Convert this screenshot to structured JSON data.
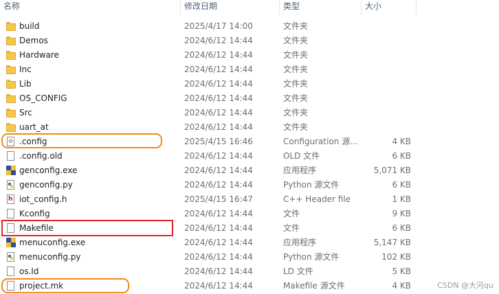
{
  "columns": {
    "name": "名称",
    "date": "修改日期",
    "type": "类型",
    "size": "大小"
  },
  "files": [
    {
      "icon": "folder-icon",
      "name": "build",
      "date": "2025/4/17 14:00",
      "type": "文件夹",
      "size": ""
    },
    {
      "icon": "folder-icon",
      "name": "Demos",
      "date": "2024/6/12 14:44",
      "type": "文件夹",
      "size": ""
    },
    {
      "icon": "folder-icon",
      "name": "Hardware",
      "date": "2024/6/12 14:44",
      "type": "文件夹",
      "size": ""
    },
    {
      "icon": "folder-icon",
      "name": "Inc",
      "date": "2024/6/12 14:44",
      "type": "文件夹",
      "size": ""
    },
    {
      "icon": "folder-icon",
      "name": "Lib",
      "date": "2024/6/12 14:44",
      "type": "文件夹",
      "size": ""
    },
    {
      "icon": "folder-icon",
      "name": "OS_CONFIG",
      "date": "2024/6/12 14:44",
      "type": "文件夹",
      "size": ""
    },
    {
      "icon": "folder-icon",
      "name": "Src",
      "date": "2024/6/12 14:44",
      "type": "文件夹",
      "size": ""
    },
    {
      "icon": "folder-icon",
      "name": "uart_at",
      "date": "2024/6/12 14:44",
      "type": "文件夹",
      "size": ""
    },
    {
      "icon": "config-file-icon",
      "name": ".config",
      "date": "2025/4/15 16:46",
      "type": "Configuration 源...",
      "size": "4 KB"
    },
    {
      "icon": "blank-file-icon",
      "name": ".config.old",
      "date": "2024/6/12 14:44",
      "type": "OLD 文件",
      "size": "6 KB"
    },
    {
      "icon": "exe-icon",
      "name": "genconfig.exe",
      "date": "2024/6/12 14:44",
      "type": "应用程序",
      "size": "5,071 KB"
    },
    {
      "icon": "python-file-icon",
      "name": "genconfig.py",
      "date": "2024/6/12 14:44",
      "type": "Python 源文件",
      "size": "6 KB"
    },
    {
      "icon": "header-file-icon",
      "name": "iot_config.h",
      "date": "2025/4/15 16:47",
      "type": "C++ Header file",
      "size": "1 KB"
    },
    {
      "icon": "blank-file-icon",
      "name": "Kconfig",
      "date": "2024/6/12 14:44",
      "type": "文件",
      "size": "9 KB"
    },
    {
      "icon": "blank-file-icon",
      "name": "Makefile",
      "date": "2024/6/12 14:44",
      "type": "文件",
      "size": "6 KB"
    },
    {
      "icon": "exe-icon",
      "name": "menuconfig.exe",
      "date": "2024/6/12 14:44",
      "type": "应用程序",
      "size": "5,147 KB"
    },
    {
      "icon": "python-file-icon",
      "name": "menuconfig.py",
      "date": "2024/6/12 14:44",
      "type": "Python 源文件",
      "size": "102 KB"
    },
    {
      "icon": "blank-file-icon",
      "name": "os.ld",
      "date": "2024/6/12 14:44",
      "type": "LD 文件",
      "size": "5 KB"
    },
    {
      "icon": "blank-file-icon",
      "name": "project.mk",
      "date": "2024/6/12 14:44",
      "type": "Makefile 源文件",
      "size": "4 KB"
    }
  ],
  "highlight_colors": {
    "orange": "#f0891c",
    "red": "#e3232b"
  },
  "watermark": "CSDN @大河qu"
}
